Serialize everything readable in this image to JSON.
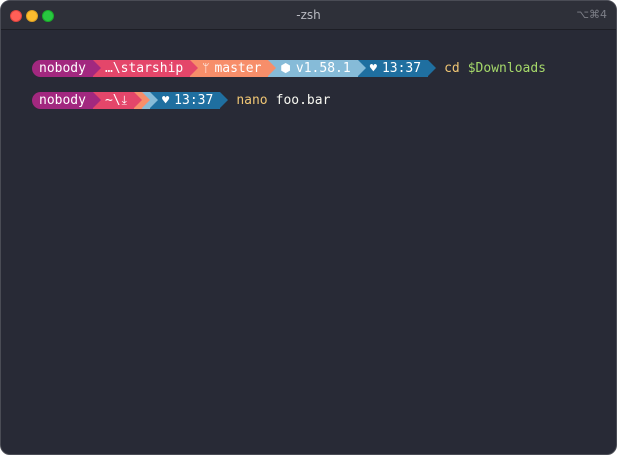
{
  "window": {
    "title": "-zsh",
    "shortcut": "⌥⌘4"
  },
  "colors": {
    "background": "#282a36",
    "user_segment": "#a2287f",
    "dir_segment": "#e4466a",
    "git_segment": "#f78e6a",
    "node_segment": "#86bbd8",
    "time_segment": "#1f6fa0",
    "command": "#f0c674",
    "variable": "#a5d86a"
  },
  "lines": [
    {
      "user": "nobody",
      "dir": "…\\starship",
      "git_icon": "git-branch-icon",
      "git_branch": "master",
      "node_icon": "node-icon",
      "node_version": "v1.58.1",
      "time_icon": "heart-icon",
      "time": "13:37",
      "command": "cd",
      "argument": "$Downloads"
    },
    {
      "user": "nobody",
      "dir": "~\\",
      "dir_icon": "download-icon",
      "time_icon": "heart-icon",
      "time": "13:37",
      "command": "nano",
      "argument": "foo.bar"
    }
  ]
}
